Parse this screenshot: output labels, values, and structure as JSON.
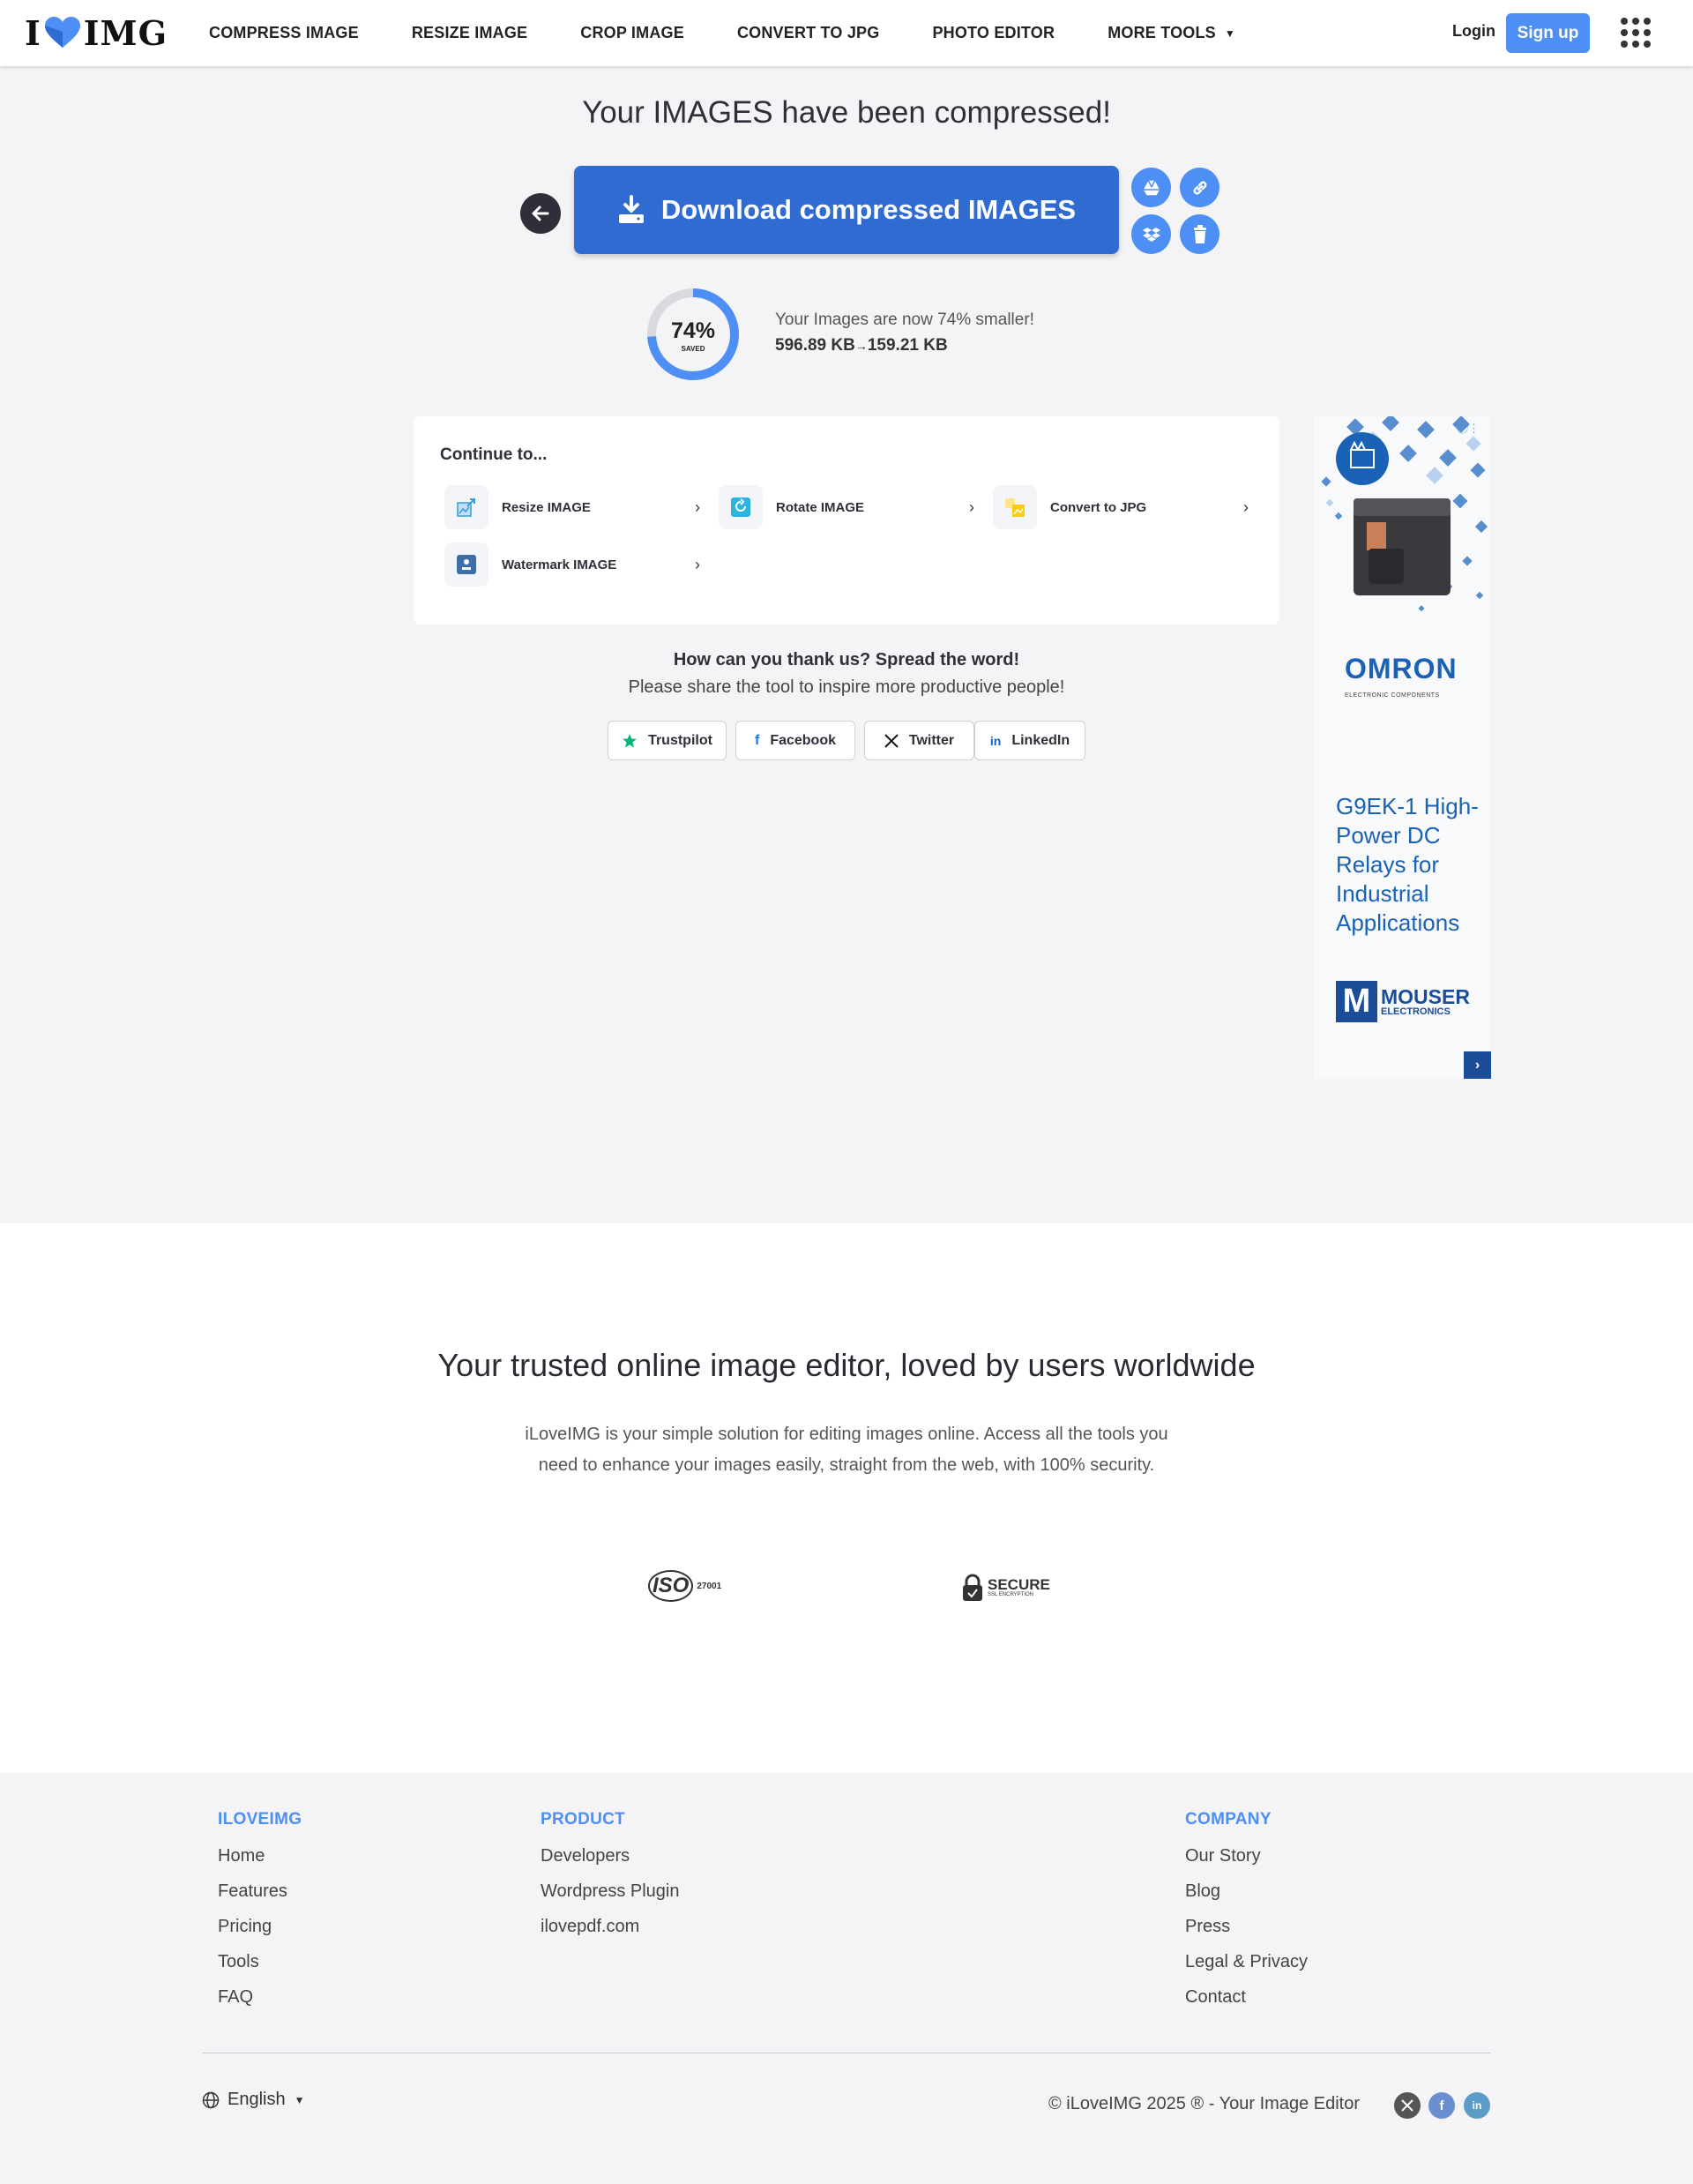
{
  "header": {
    "logo_left": "I",
    "logo_right": "IMG",
    "nav": [
      {
        "label": "COMPRESS IMAGE"
      },
      {
        "label": "RESIZE IMAGE"
      },
      {
        "label": "CROP IMAGE"
      },
      {
        "label": "CONVERT TO JPG"
      },
      {
        "label": "PHOTO EDITOR"
      },
      {
        "label": "MORE TOOLS"
      }
    ],
    "login": "Login",
    "signup": "Sign up"
  },
  "result": {
    "title": "Your IMAGES have been compressed!",
    "download_label": "Download compressed IMAGES",
    "saved_percent": "74%",
    "saved_label": "SAVED",
    "saved_fraction": 0.74,
    "smaller_text": "Your Images are now 74% smaller!",
    "size_before": "596.89 KB",
    "size_after": "159.21 KB"
  },
  "continue": {
    "title": "Continue to...",
    "items": [
      {
        "label": "Resize IMAGE",
        "icon": "resize-icon"
      },
      {
        "label": "Rotate IMAGE",
        "icon": "rotate-icon"
      },
      {
        "label": "Convert to JPG",
        "icon": "convert-jpg-icon"
      },
      {
        "label": "Watermark IMAGE",
        "icon": "watermark-icon"
      }
    ]
  },
  "share": {
    "question": "How can you thank us? Spread the word!",
    "subtitle": "Please share the tool to inspire more productive people!",
    "buttons": [
      {
        "label": "Trustpilot",
        "icon": "star-icon"
      },
      {
        "label": "Facebook",
        "icon": "facebook-icon"
      },
      {
        "label": "Twitter",
        "icon": "x-icon"
      },
      {
        "label": "LinkedIn",
        "icon": "linkedin-icon"
      }
    ]
  },
  "ad": {
    "brand": "OMRON",
    "brand_sub": "ELECTRONIC COMPONENTS",
    "headline": "G9EK-1 High-Power DC Relays for Industrial Applications",
    "distributor": "MOUSER",
    "distributor_sub": "ELECTRONICS",
    "distributor_letter": "M"
  },
  "trust": {
    "title": "Your trusted online image editor, loved by users worldwide",
    "text": "iLoveIMG is your simple solution for editing images online. Access all the tools you need to enhance your images easily, straight from the web, with 100% security.",
    "iso_label": "ISO",
    "iso_number": "27001",
    "ssl_label": "SECURE",
    "ssl_sub": "SSL ENCRYPTION"
  },
  "footer": {
    "columns": [
      {
        "heading": "ILOVEIMG",
        "links": [
          "Home",
          "Features",
          "Pricing",
          "Tools",
          "FAQ"
        ]
      },
      {
        "heading": "PRODUCT",
        "links": [
          "Developers",
          "Wordpress Plugin",
          "ilovepdf.com"
        ]
      },
      {
        "heading": "COMPANY",
        "links": [
          "Our Story",
          "Blog",
          "Press",
          "Legal & Privacy",
          "Contact"
        ]
      }
    ],
    "language": "English",
    "copyright": "© iLoveIMG 2025 ® - Your Image Editor"
  },
  "colors": {
    "brand_blue": "#4d8ff5",
    "download_blue": "#2f6bd1",
    "ring_track": "#d9d9de"
  }
}
